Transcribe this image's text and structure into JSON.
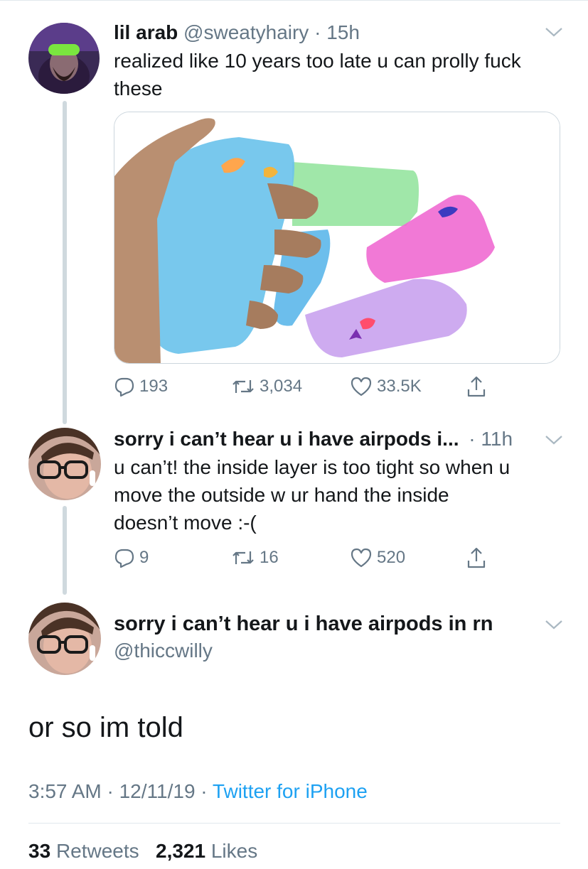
{
  "tweets": [
    {
      "display_name": "lil arab",
      "handle": "@sweatyhairy",
      "time": "· 15h",
      "text_lines": [
        "realized like 10 years too late u can prolly fuck",
        "these"
      ],
      "replies": "193",
      "retweets": "3,034",
      "likes": "33.5K"
    },
    {
      "display_name": "sorry i can’t hear u i have airpods i...",
      "time": "· 11h",
      "text_lines": [
        "u can’t! the inside layer is too tight so when u",
        "move the outside w ur hand the inside",
        "doesn’t move :-("
      ],
      "replies": "9",
      "retweets": "16",
      "likes": "520"
    }
  ],
  "focus": {
    "display_name": "sorry i can’t hear u i have airpods in rn",
    "handle": "@thiccwilly",
    "text": "or so im told",
    "time": "3:57 AM · 12/11/19 ·",
    "source": "Twitter for iPhone",
    "retweet_count": "33",
    "retweet_label": "Retweets",
    "like_count": "2,321",
    "like_label": "Likes"
  },
  "colors": {
    "text": "#14171a",
    "secondary": "#657786",
    "link": "#1da1f2",
    "thread_line": "#cfd9de",
    "divider": "#e1e8ed"
  },
  "icons": [
    "reply-icon",
    "retweet-icon",
    "like-icon",
    "share-icon",
    "chevron-down-icon"
  ]
}
